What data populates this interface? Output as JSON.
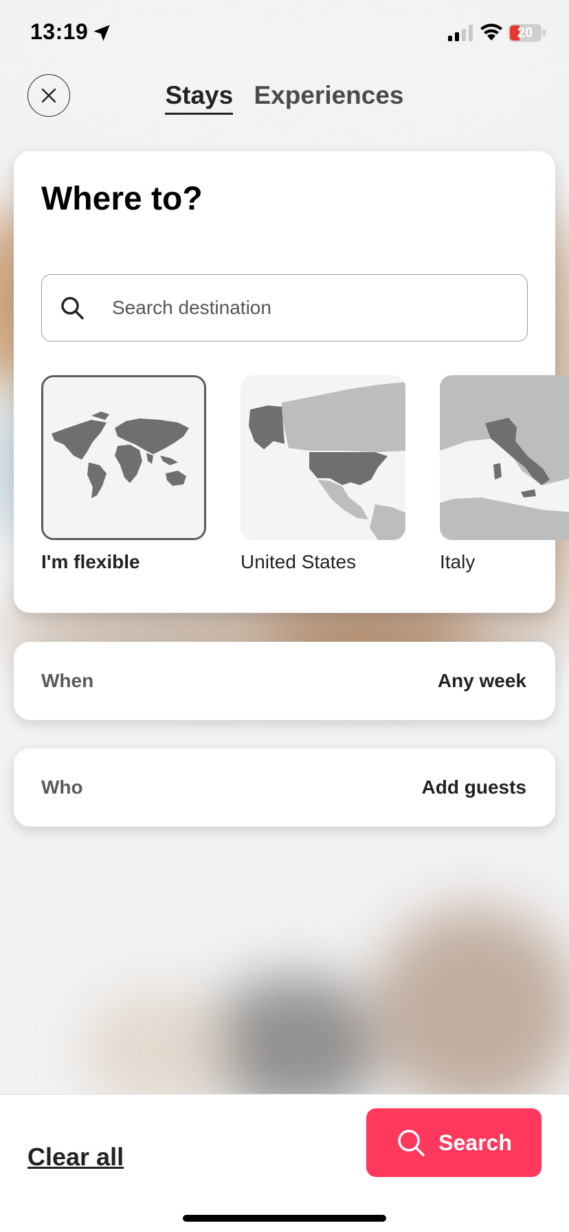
{
  "status_bar": {
    "time": "13:19",
    "battery": "20"
  },
  "header": {
    "tabs": [
      {
        "label": "Stays",
        "active": true
      },
      {
        "label": "Experiences",
        "active": false
      }
    ]
  },
  "where": {
    "title": "Where to?",
    "search_placeholder": "Search destination",
    "destinations": [
      {
        "label": "I'm flexible",
        "selected": true
      },
      {
        "label": "United States",
        "selected": false
      },
      {
        "label": "Italy",
        "selected": false
      }
    ]
  },
  "when": {
    "label": "When",
    "value": "Any week"
  },
  "who": {
    "label": "Who",
    "value": "Add guests"
  },
  "footer": {
    "clear_label": "Clear all",
    "search_label": "Search"
  },
  "colors": {
    "accent": "#ff385c",
    "map_dark": "#6f6f6f",
    "map_light": "#bdbdbd"
  }
}
